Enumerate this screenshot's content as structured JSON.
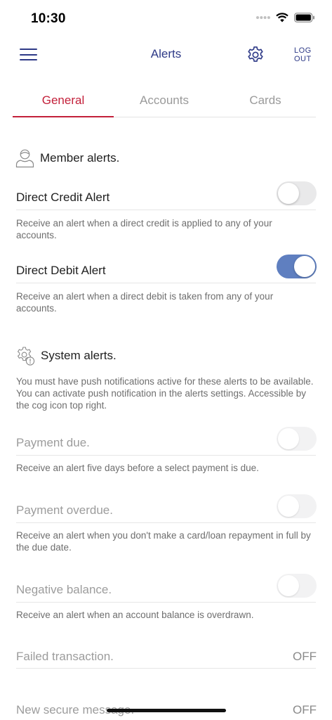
{
  "status_bar": {
    "time": "10:30"
  },
  "nav": {
    "title": "Alerts",
    "logout_line1": "LOG",
    "logout_line2": "OUT"
  },
  "tabs": [
    {
      "label": "General",
      "active": true
    },
    {
      "label": "Accounts",
      "active": false
    },
    {
      "label": "Cards",
      "active": false
    }
  ],
  "member_section": {
    "title": "Member alerts.",
    "items": [
      {
        "title": "Direct Credit Alert",
        "description": "Receive an alert when a direct credit is applied to any of your accounts.",
        "enabled": false
      },
      {
        "title": "Direct Debit Alert",
        "description": "Receive an alert when a direct debit is taken from any of your accounts.",
        "enabled": true
      }
    ]
  },
  "system_section": {
    "title": "System alerts.",
    "note": "You must have push notifications active for these alerts to be available. You can activate push notification in the alerts settings. Accessible by the cog icon top right.",
    "items": [
      {
        "title": "Payment due.",
        "description": "Receive an alert five days before a select payment is due.",
        "enabled": false
      },
      {
        "title": "Payment overdue.",
        "description": "Receive an alert when you don't make a card/loan repayment in full by the due date.",
        "enabled": false
      },
      {
        "title": "Negative balance.",
        "description": "Receive an alert when an account balance is overdrawn.",
        "enabled": false
      },
      {
        "title": "Failed transaction.",
        "status": "OFF"
      },
      {
        "title": "New secure message.",
        "status": "OFF"
      }
    ]
  },
  "colors": {
    "brand_navy": "#2e3a87",
    "active_tab": "#c3203a",
    "toggle_on": "#5f7fc0"
  }
}
